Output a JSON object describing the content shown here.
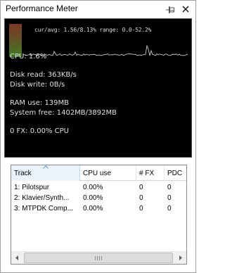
{
  "window": {
    "title": "Performance Meter"
  },
  "meter": {
    "graph_label": "cur/avg: 1.56/8.13%  range: 0.0-52.2%",
    "cpu": "CPU: 1.6%",
    "disk_read": "Disk read: 363KB/s",
    "disk_write": "Disk write: 0B/s",
    "ram_use": "RAM use: 139MB",
    "system_free": "System free: 1402MB/3892MB",
    "fx": "0 FX: 0.00% CPU",
    "graph_color": "#e0e0e0",
    "history_bar_color": "#4a6a28"
  },
  "table": {
    "columns": [
      "Track",
      "CPU use",
      "# FX",
      "PDC"
    ],
    "sorted_column": "Track",
    "rows": [
      {
        "track": "1: Pilotspur",
        "cpu": "0.00%",
        "fx": "0",
        "pdc": "0"
      },
      {
        "track": "2: Klavier/Synth...",
        "cpu": "0.00%",
        "fx": "0",
        "pdc": "0"
      },
      {
        "track": "3: MTPDK Comp...",
        "cpu": "0.00%",
        "fx": "0",
        "pdc": "0"
      }
    ]
  },
  "icons": {
    "pin": "pin-icon",
    "close": "close-icon",
    "scroll_left": "arrow-left-icon",
    "scroll_right": "arrow-right-icon",
    "sort": "sort-ascending-icon"
  }
}
